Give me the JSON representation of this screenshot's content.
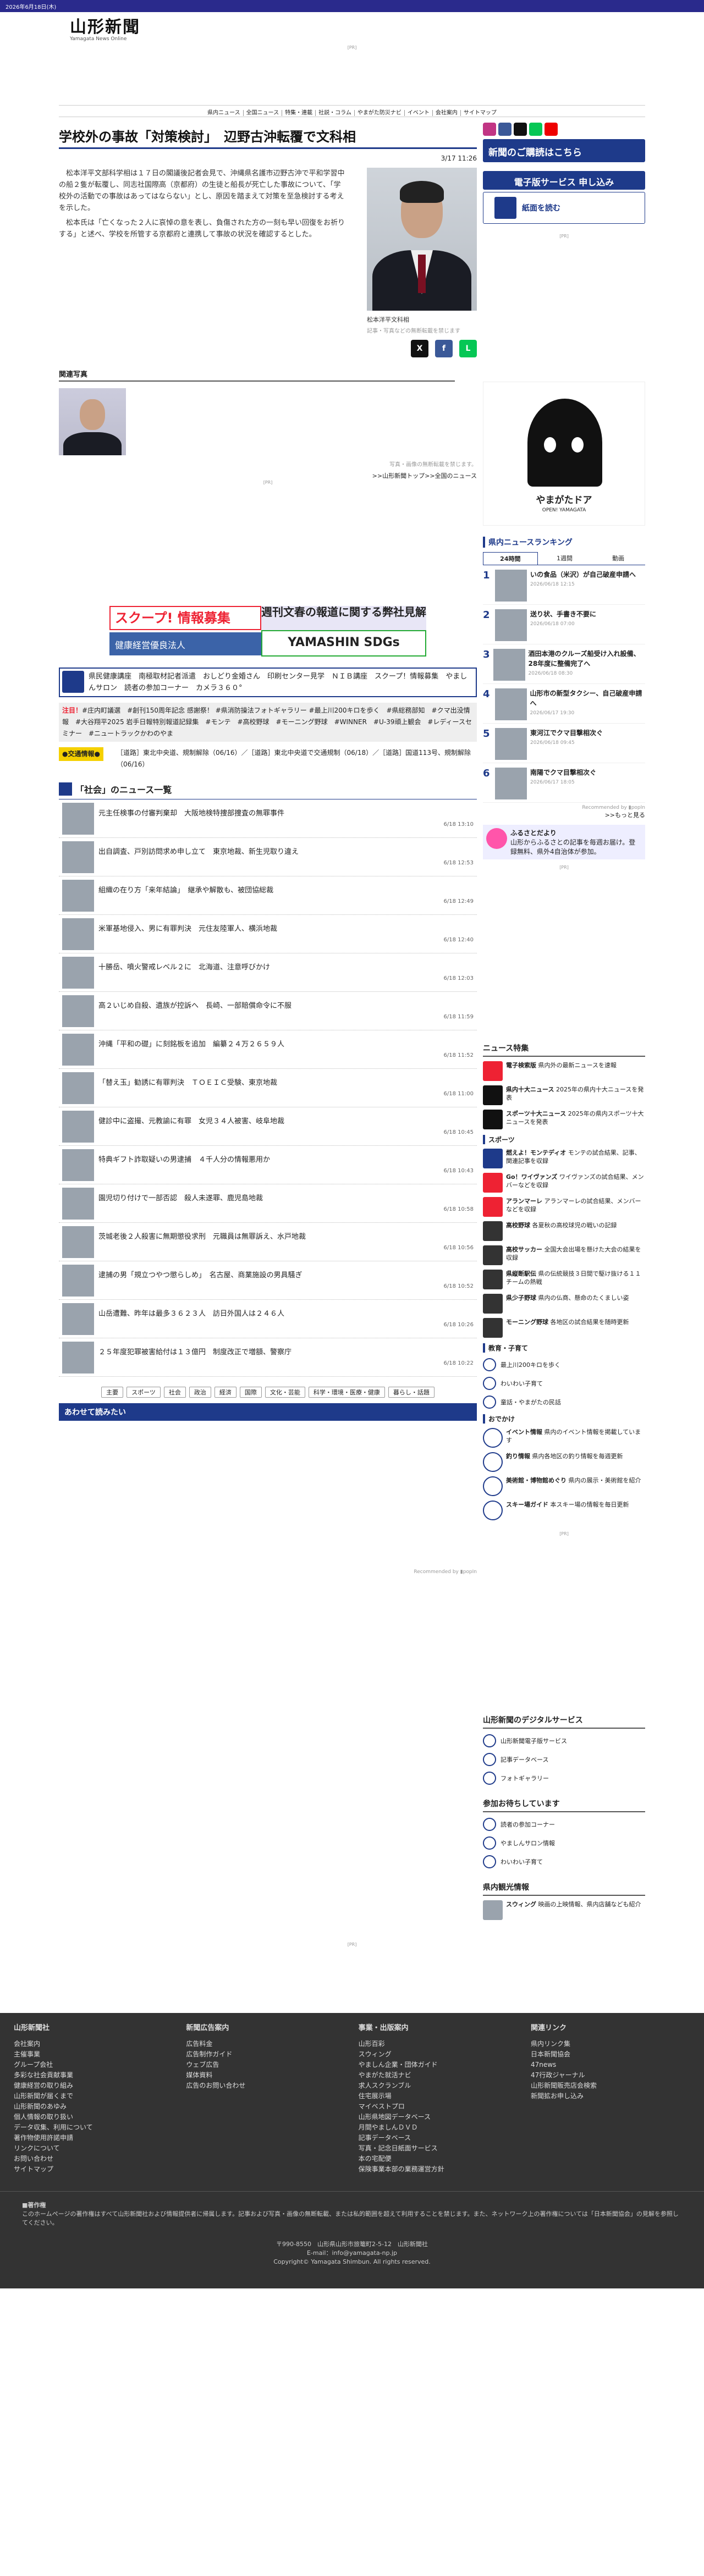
{
  "topbar": {
    "date": "2026年6月18日(木)"
  },
  "logo": {
    "main": "山形新聞",
    "sub": "Yamagata News Online"
  },
  "ad_label": "[PR]",
  "nav": [
    "県内ニュース",
    "全国ニュース",
    "特集・連載",
    "社説・コラム",
    "やまがた防災ナビ",
    "イベント",
    "会社案内",
    "サイトマップ"
  ],
  "article": {
    "title": "学校外の事故「対策検討」　辺野古沖転覆で文科相",
    "date": "3/17 11:26",
    "paragraphs": [
      "松本洋平文部科学相は１７日の閣議後記者会見で、沖縄県名護市辺野古沖で平和学習中の船２隻が転覆し、同志社国際高（京都府）の生徒と船長が死亡した事故について、「学校外の活動での事故はあってはならない」とし、原因を踏まえて対策を至急検討する考えを示した。",
      "松本氏は「亡くなった２人に哀悼の意を表し、負傷された方の一刻も早い回復をお祈りする」と述べ、学校を所管する京都府と連携して事故の状況を確認するとした。"
    ],
    "photo_caption": "松本洋平文科相",
    "photo_note": "記事・写真などの無断転載を禁じます",
    "related_heading": "関連写真",
    "photo_notice": "写真・画像の無断転載を禁じます。",
    "breadcrumb": ">>山形新聞トップ>>全国のニュース"
  },
  "share": [
    "X",
    "f",
    "L"
  ],
  "banners": {
    "scoop": "スクープ! 情報募集",
    "health": "健康経営優良法人",
    "bunshun": "週刊文春の報道に関する弊社見解",
    "sdgs": "YAMASHIN SDGs"
  },
  "ticker1": "県民健康講座　南極取材記者派遣　おしどり金婚さん　印刷センター見学　ＮＩＢ講座　スクープ！情報募集　やましんサロン　読者の参加コーナー　カメラ３６０°",
  "ticker2": {
    "label": "注目！",
    "text": "#庄内町議選　#創刊150周年記念 感謝祭！ #県消防操法フォトギャラリー #最上川200キロを歩く　#県総務部知　#クマ出没情報　#大谷翔平2025 岩手日報特別報道記録集　#モンテ　#高校野球　#モーニング野球　#WINNER　#U-39頑上観会　#レディースセミナー　#ニュートラックかわのやま"
  },
  "traffic": {
    "label": "●交通情報●",
    "text": "［道路］東北中央道、規制解除（06/16）／［道路］東北中央道で交通規制（06/18）／［道路］国道113号、規制解除（06/16）"
  },
  "list": {
    "heading": "「社会」のニュース一覧",
    "items": [
      {
        "title": "元主任検事の付審判棄却　大阪地検特捜部捜査の無罪事件",
        "time": "6/18 13:10"
      },
      {
        "title": "出自調査、戸別訪問求め申し立て　東京地裁、新生児取り違え",
        "time": "6/18 12:53"
      },
      {
        "title": "組織の在り方「来年結論」　継承や解散も、被団協総裁",
        "time": "6/18 12:49"
      },
      {
        "title": "米軍基地侵入、男に有罪判決　元住友陸軍人、横浜地裁",
        "time": "6/18 12:40"
      },
      {
        "title": "十勝岳、噴火警戒レベル２に　北海道、注意呼びかけ",
        "time": "6/18 12:03"
      },
      {
        "title": "高２いじめ自殺、遺族が控訴へ　長崎、一部賠償命令に不服",
        "time": "6/18 11:59"
      },
      {
        "title": "沖縄「平和の礎」に刻銘板を追加　編纂２４万２６５９人",
        "time": "6/18 11:52"
      },
      {
        "title": "「替え玉」勧誘に有罪判決　ＴＯＥＩＣ受験、東京地裁",
        "time": "6/18 11:00"
      },
      {
        "title": "健診中に盗撮、元教諭に有罪　女児３４人被害、岐阜地裁",
        "time": "6/18 10:45"
      },
      {
        "title": "特典ギフト詐取疑いの男逮捕　４千人分の情報悪用か",
        "time": "6/18 10:43"
      },
      {
        "title": "園児切り付けで一部否認　殺人未遂罪、鹿児島地裁",
        "time": "6/18 10:58"
      },
      {
        "title": "茨城老後２人殺害に無期懲役求刑　元職員は無罪訴え、水戸地裁",
        "time": "6/18 10:56"
      },
      {
        "title": "逮捕の男「規立つやつ懲らしめ」　名古屋、商業施設の男具騒ぎ",
        "time": "6/18 10:52"
      },
      {
        "title": "山岳遭難、昨年は最多３６２３人　訪日外国人は２４６人",
        "time": "6/18 10:26"
      },
      {
        "title": "２５年度犯罪被害給付は１３億円　制度改正で増額、警察庁",
        "time": "6/18 10:22"
      }
    ]
  },
  "categories": [
    "主要",
    "スポーツ",
    "社会",
    "政治",
    "経済",
    "国際",
    "文化・芸能",
    "科学・環境・医療・健康",
    "暮らし・話題"
  ],
  "recommend_bar": "あわせて読みたい",
  "recommend_credit": "Recommended by ▮popIn",
  "side": {
    "sub_button": "新聞のご購読はこちら",
    "e_button": "電子版サービス 申し込み",
    "paper_button": "紙面を読む",
    "doa_title": "やまがたドア",
    "doa_sub": "OPEN! YAMAGATA",
    "ranking_heading": "県内ニュースランキング",
    "ranking_tabs": [
      "24時間",
      "1週間",
      "動画"
    ],
    "ranking": [
      {
        "n": "1",
        "title": "いの食品（米沢）が自己破産申請へ",
        "date": "2026/06/18 12:15"
      },
      {
        "n": "2",
        "title": "送り状、手書き不要に",
        "date": "2026/06/18 07:00"
      },
      {
        "n": "3",
        "title": "酒田本港のクルーズ船受け入れ設備、28年度に整備完了へ",
        "date": "2026/06/18 08:30"
      },
      {
        "n": "4",
        "title": "山形市の新型タクシー、自己破産申請へ",
        "date": "2026/06/17 19:30"
      },
      {
        "n": "5",
        "title": "東河江でクマ目撃相次ぐ",
        "date": "2026/06/18 09:45"
      },
      {
        "n": "6",
        "title": "南陽でクマ目撃相次ぐ",
        "date": "2026/06/17 18:05"
      }
    ],
    "ranking_credit": "Recommended by ▮popIn",
    "more": ">>もっと見る",
    "furusato_title": "ふるさとだより",
    "furusato_text": "山形からふるさとの記事を毎週お届け。登録無料、県外4自治体が参加。",
    "feature_heading": "ニュース特集",
    "features": [
      {
        "t": "電子検索版",
        "d": "県内外の最新ニュースを速報",
        "c": "#e23"
      },
      {
        "t": "県内十大ニュース",
        "d": "2025年の県内十大ニュースを発表",
        "c": "#111"
      },
      {
        "t": "スポーツ十大ニュース",
        "d": "2025年の県内スポーツ十大ニュースを発表",
        "c": "#111"
      }
    ],
    "sports_heading": "スポーツ",
    "sports": [
      {
        "t": "燃えよ！モンテディオ",
        "d": "モンテの試合結果、記事、関連記事を収録",
        "c": "#1e3a8a"
      },
      {
        "t": "Go！ワイヴァンズ",
        "d": "ワイヴァンズの試合結果、メンバーなどを収録",
        "c": "#e23"
      },
      {
        "t": "アランマーレ",
        "d": "アランマーレの試合結果、メンバーなどを収録",
        "c": "#e23"
      },
      {
        "t": "高校野球",
        "d": "各夏秋の高校球児の戦いの記録",
        "c": "#333"
      },
      {
        "t": "高校サッカー",
        "d": "全国大会出場を懸けた大会の結果を収録",
        "c": "#333"
      },
      {
        "t": "県縦断駅伝",
        "d": "県の伝統競技３日間で駆け抜ける１１チームの熱戦",
        "c": "#333"
      },
      {
        "t": "県少子野球",
        "d": "県内の仏商、懸命のたくましい姿",
        "c": "#333"
      },
      {
        "t": "モーニング野球",
        "d": "各地区の試合結果を随時更新",
        "c": "#333"
      }
    ],
    "edu_heading": "教育・子育て",
    "edu": [
      "最上川200キロを歩く",
      "わいわい子育て",
      "童話・やまがたの民話"
    ],
    "outing_heading": "おでかけ",
    "outing": [
      {
        "t": "イベント情報",
        "d": "県内のイベント情報を掲載しています"
      },
      {
        "t": "釣り情報",
        "d": "県内各地区の釣り情報を毎週更新"
      },
      {
        "t": "美術館・博物館めぐり",
        "d": "県内の展示・美術館を紹介"
      },
      {
        "t": "スキー場ガイド",
        "d": "本スキー場の情報を毎日更新"
      }
    ],
    "digital_heading": "山形新聞のデジタルサービス",
    "digital": [
      "山形新聞電子版サービス",
      "記事データベース",
      "フォトギャラリー"
    ],
    "join_heading": "参加お待ちしています",
    "join": [
      "読者の参加コーナー",
      "やましんサロン情報",
      "わいわい子育て"
    ],
    "tourism_heading": "県内観光情報",
    "tourism": {
      "t": "スウィング",
      "d": "映画の上映情報、県内店舗なども紹介"
    }
  },
  "footer": {
    "cols": [
      {
        "h": "山形新聞社",
        "items": [
          "会社案内",
          "主催事業",
          "グループ会社",
          "多彩な社会貢献事業",
          "健康経営の取り組み",
          "山形新聞が届くまで",
          "山形新聞のあゆみ",
          "個人情報の取り扱い",
          "データ収集、利用について",
          "著作物使用許諾申請",
          "リンクについて",
          "お問い合わせ",
          "サイトマップ"
        ]
      },
      {
        "h": "新聞広告案内",
        "items": [
          "広告料金",
          "広告制作ガイド",
          "ウェブ広告",
          "媒体資料",
          "広告のお問い合わせ"
        ]
      },
      {
        "h": "事業・出版案内",
        "items": [
          "山形百彩",
          "スウィング",
          "やましん企業・団体ガイド",
          "やまがた就活ナビ",
          "求人スクランブル",
          "住宅展示場",
          "マイベストプロ",
          "山形県地図データベース",
          "月間やましんＤＶＤ",
          "記事データベース",
          "写真・記念日紙面サービス",
          "本の宅配便",
          "保険事業本部の業務運営方針"
        ]
      },
      {
        "h": "関連リンク",
        "items": [
          "県内リンク集",
          "日本新聞協会",
          "47news",
          "47行政ジャーナル",
          "山形新聞販売店会検索",
          "新聞拡お申し込み"
        ]
      }
    ],
    "copyright_heading": "■著作権",
    "copyright_text": "このホームページの著作権はすべて山形新聞社および情報提供者に帰属します。記事および写真・画像の無断転載、または私的範囲を超えて利用することを禁じます。また、ネットワーク上の著作権については「日本新聞協会」の見解を参照してください。",
    "address": "〒990-8550　山形県山形市旅篭町2-5-12　山形新聞社",
    "email": "E-mail：info@yamagata-np.jp",
    "copy": "Copyright© Yamagata Shimbun. All rights reserved."
  }
}
